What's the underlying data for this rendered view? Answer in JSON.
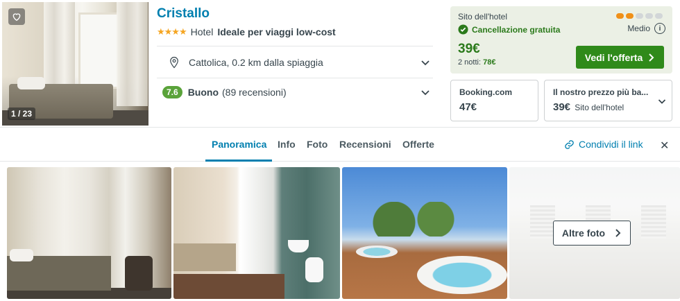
{
  "hotel": {
    "name": "Cristallo",
    "stars": "★★★★",
    "type": "Hotel",
    "tagline": "Ideale per viaggi low-cost",
    "location": "Cattolica, 0.2 km dalla spiaggia",
    "score": "7.6",
    "score_label": "Buono",
    "reviews": "(89 recensioni)",
    "photo_counter": "1 / 23"
  },
  "deal": {
    "site": "Sito dell'hotel",
    "cancellation": "Cancellazione gratuita",
    "price": "39€",
    "nights_label": "2 notti:",
    "nights_total": "78€",
    "price_level": "Medio",
    "price_level_dots": 2,
    "cta": "Vedi l'offerta"
  },
  "alternatives": [
    {
      "name": "Booking.com",
      "price": "47€",
      "note": ""
    },
    {
      "name": "Il nostro prezzo più ba...",
      "price": "39€",
      "note": "Sito dell'hotel"
    }
  ],
  "tabs": [
    "Panoramica",
    "Info",
    "Foto",
    "Recensioni",
    "Offerte"
  ],
  "share_label": "Condividi il link",
  "gallery": {
    "more_label": "Altre foto"
  },
  "colors": {
    "brand_blue": "#007faf",
    "deal_green": "#2f8a1a",
    "deal_bg": "#ebf0e5",
    "score_green": "#5aa33a",
    "level_orange": "#f09018"
  }
}
